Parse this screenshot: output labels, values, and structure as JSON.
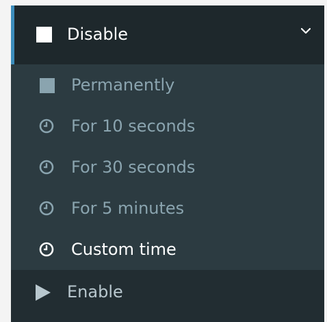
{
  "menu": {
    "disable_label": "Disable",
    "submenu": [
      {
        "label": "Permanently",
        "icon": "stop-square-icon"
      },
      {
        "label": "For 10 seconds",
        "icon": "clock-icon"
      },
      {
        "label": "For 30 seconds",
        "icon": "clock-icon"
      },
      {
        "label": "For 5 minutes",
        "icon": "clock-icon"
      },
      {
        "label": "Custom time",
        "icon": "clock-icon",
        "active": true
      }
    ],
    "enable_label": "Enable"
  },
  "colors": {
    "sidebar_bg": "#222d32",
    "header_bg": "#1e282c",
    "submenu_bg": "#2c3b41",
    "accent": "#3c8dbc",
    "muted_text": "#8aa4af",
    "active_text": "#ffffff"
  }
}
